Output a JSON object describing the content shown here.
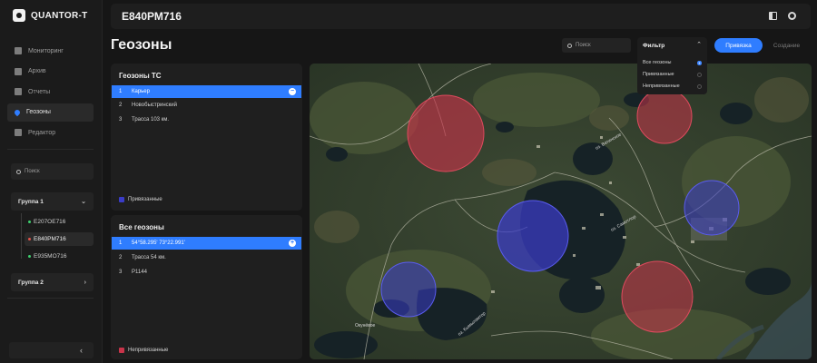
{
  "app": {
    "name": "QUANTOR-T"
  },
  "sidebar": {
    "nav": [
      {
        "label": "Мониторинг",
        "icon": "monitoring-icon",
        "active": false
      },
      {
        "label": "Архив",
        "icon": "archive-icon",
        "active": false
      },
      {
        "label": "Отчеты",
        "icon": "reports-icon",
        "active": false
      },
      {
        "label": "Геозоны",
        "icon": "geozone-pin-icon",
        "active": true
      },
      {
        "label": "Редактор",
        "icon": "pencil-icon",
        "active": false
      }
    ],
    "search_placeholder": "Поиск",
    "groups": [
      {
        "label": "Группа 1",
        "expanded": true
      },
      {
        "label": "Группа 2",
        "expanded": false
      }
    ],
    "vehicles": [
      {
        "label": "Е207ОЕ716",
        "status_color": "#3ecf6e",
        "active": false
      },
      {
        "label": "Е840РМ716",
        "status_color": "#e0534a",
        "active": true
      },
      {
        "label": "Е935МО716",
        "status_color": "#3ecf6e",
        "active": false
      }
    ],
    "collapse_glyph": "‹"
  },
  "header": {
    "vehicle": "Е840РМ716"
  },
  "page": {
    "title": "Геозоны"
  },
  "search": {
    "placeholder": "Поиск"
  },
  "mode_switch": {
    "bind": "Привязка",
    "create": "Создание",
    "active": "bind"
  },
  "filter": {
    "title": "Фильтр",
    "options": [
      {
        "label": "Все геозоны",
        "selected": true
      },
      {
        "label": "Привязанные",
        "selected": false
      },
      {
        "label": "Непривязанные",
        "selected": false
      }
    ]
  },
  "vehicle_geozones": {
    "title": "Геозоны ТС",
    "rows": [
      {
        "num": "1",
        "label": "Карьер",
        "selected": true
      },
      {
        "num": "2",
        "label": "Новобыстринский",
        "selected": false
      },
      {
        "num": "3",
        "label": "Трасса 103 км.",
        "selected": false
      }
    ],
    "legend": "Привязанные"
  },
  "all_geozones": {
    "title": "Все геозоны",
    "rows": [
      {
        "num": "1",
        "label": "54°58.295' 73°22.991'",
        "selected": true
      },
      {
        "num": "2",
        "label": "Трасса 54 км.",
        "selected": false
      },
      {
        "num": "3",
        "label": "Р1144",
        "selected": false
      }
    ],
    "legend": "Непривязанные"
  },
  "colors": {
    "accent": "#2f7dff",
    "bound": "#3a3cc8",
    "unbound": "#c9344a",
    "panel": "#1f1f1f",
    "background": "#161616"
  },
  "map": {
    "labels": [
      "оз. Самотлор",
      "Окунёвое",
      "оз. Кымылэмтор",
      "оз. Ватинское"
    ],
    "zones": [
      "unbound",
      "unbound",
      "bound",
      "bound",
      "bound",
      "unbound"
    ]
  }
}
